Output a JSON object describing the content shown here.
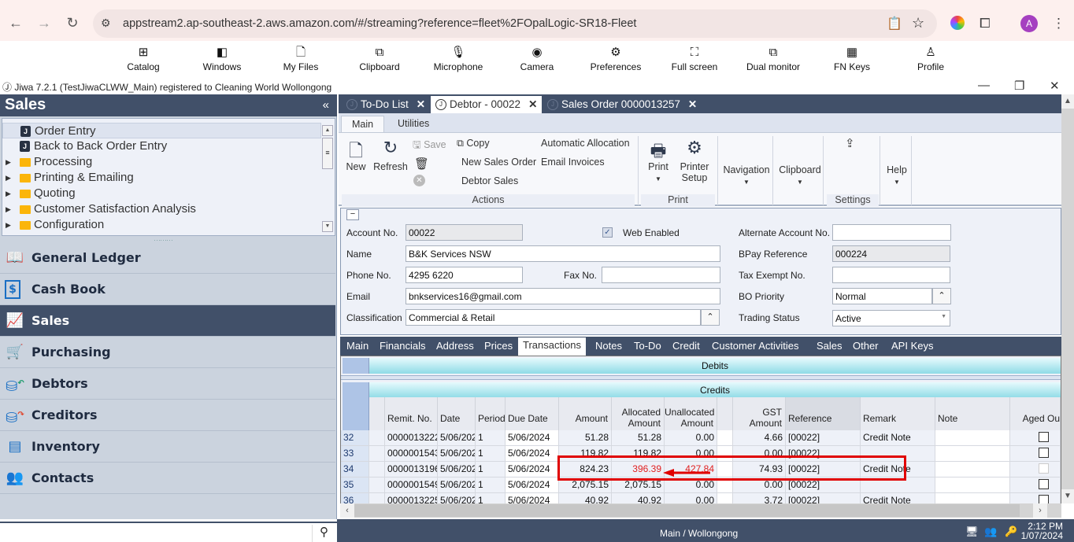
{
  "browser": {
    "url": "appstream2.ap-southeast-2.aws.amazon.com/#/streaming?reference=fleet%2FOpalLogic-SR18-Fleet",
    "back_icon": "arrow-left-icon",
    "forward_icon": "arrow-right-icon",
    "reload_icon": "reload-icon",
    "profile_initial": "A"
  },
  "appstream_toolbar": [
    {
      "label": "Catalog",
      "icon": "catalog-icon",
      "glyph": "⊞"
    },
    {
      "label": "Windows",
      "icon": "windows-icon",
      "glyph": "◧"
    },
    {
      "label": "My Files",
      "icon": "file-icon",
      "glyph": "🗋"
    },
    {
      "label": "Clipboard",
      "icon": "clipboard-icon",
      "glyph": "⧉"
    },
    {
      "label": "Microphone",
      "icon": "microphone-off-icon",
      "glyph": "🎙"
    },
    {
      "label": "Camera",
      "icon": "camera-icon",
      "glyph": "◉"
    },
    {
      "label": "Preferences",
      "icon": "gear-icon",
      "glyph": "⚙"
    },
    {
      "label": "Full screen",
      "icon": "fullscreen-icon",
      "glyph": "⛶"
    },
    {
      "label": "Dual monitor",
      "icon": "dual-monitor-icon",
      "glyph": "⧉"
    },
    {
      "label": "FN Keys",
      "icon": "keyboard-icon",
      "glyph": "▦"
    },
    {
      "label": "Profile",
      "icon": "user-icon",
      "glyph": "⍝"
    }
  ],
  "app": {
    "title": "Jiwa 7.2.1 (TestJiwaCLWW_Main) registered to Cleaning World Wollongong"
  },
  "sidebar": {
    "title": "Sales",
    "collapse_glyph": "«",
    "tree": [
      {
        "label": "Order Entry",
        "type": "item",
        "selected": true
      },
      {
        "label": "Back to Back Order Entry",
        "type": "item"
      },
      {
        "label": "Processing",
        "type": "folder"
      },
      {
        "label": "Printing & Emailing",
        "type": "folder"
      },
      {
        "label": "Quoting",
        "type": "folder"
      },
      {
        "label": "Customer Satisfaction Analysis",
        "type": "folder"
      },
      {
        "label": "Configuration",
        "type": "folder"
      }
    ],
    "modules": [
      {
        "label": "General Ledger",
        "icon": "ledger-book-icon",
        "glyph": "📖"
      },
      {
        "label": "Cash Book",
        "icon": "cash-book-icon",
        "glyph": "$"
      },
      {
        "label": "Sales",
        "icon": "sales-chart-icon",
        "glyph": "📈",
        "active": true
      },
      {
        "label": "Purchasing",
        "icon": "cart-icon",
        "glyph": "🛒"
      },
      {
        "label": "Debtors",
        "icon": "debtors-coins-icon",
        "glyph": "⛁"
      },
      {
        "label": "Creditors",
        "icon": "creditors-coins-icon",
        "glyph": "⛁"
      },
      {
        "label": "Inventory",
        "icon": "inventory-icon",
        "glyph": "▤"
      },
      {
        "label": "Contacts",
        "icon": "contacts-icon",
        "glyph": "👥"
      }
    ],
    "search_placeholder": ""
  },
  "doc_tabs": [
    {
      "label": "To-Do List"
    },
    {
      "label": "Debtor - 00022",
      "active": true
    },
    {
      "label": "Sales Order 0000013257"
    }
  ],
  "ribbon": {
    "tabs": [
      "Main",
      "Utilities"
    ],
    "new": "New",
    "refresh": "Refresh",
    "save": "Save",
    "copy": "Copy",
    "new_sales_order": "New Sales Order",
    "debtor_sales": "Debtor Sales",
    "automatic_allocation": "Automatic Allocation",
    "email_invoices": "Email Invoices",
    "actions_group": "Actions",
    "print": "Print",
    "printer_setup_1": "Printer",
    "printer_setup_2": "Setup",
    "print_group": "Print",
    "navigation": "Navigation",
    "clipboard": "Clipboard",
    "settings_group": "Settings",
    "help": "Help"
  },
  "form": {
    "account_no_label": "Account No.",
    "account_no": "00022",
    "web_enabled_label": "Web Enabled",
    "web_enabled": true,
    "name_label": "Name",
    "name": "B&K Services NSW",
    "phone_label": "Phone No.",
    "phone": "4295 6220",
    "fax_label": "Fax No.",
    "fax": "",
    "email_label": "Email",
    "email": "bnkservices16@gmail.com",
    "classification_label": "Classification",
    "classification": "Commercial & Retail",
    "alt_account_label": "Alternate Account No.",
    "alt_account": "",
    "bpay_label": "BPay Reference",
    "bpay": "000224",
    "tax_exempt_label": "Tax Exempt No.",
    "tax_exempt": "",
    "bo_priority_label": "BO Priority",
    "bo_priority": "Normal",
    "trading_status_label": "Trading Status",
    "trading_status": "Active"
  },
  "detail_tabs": [
    {
      "label": "Main"
    },
    {
      "label": "Financials"
    },
    {
      "label": "Address"
    },
    {
      "label": "Prices"
    },
    {
      "label": "Transactions",
      "active": true
    },
    {
      "label": "Notes"
    },
    {
      "label": "To-Do"
    },
    {
      "label": "Credit"
    },
    {
      "label": "Customer Activities"
    },
    {
      "label": "Sales"
    },
    {
      "label": "Other"
    },
    {
      "label": "API Keys"
    }
  ],
  "grid": {
    "debits_band": "Debits",
    "credits_band": "Credits",
    "columns": [
      "Remit. No.",
      "Date",
      "Period",
      "Due Date",
      "Amount",
      "Allocated Amount",
      "Unallocated Amount",
      "",
      "GST Amount",
      "Reference",
      "Remark",
      "Note",
      "Aged Ou"
    ],
    "rows": [
      {
        "n": "32",
        "remit": "0000013222-",
        "date": "5/06/202",
        "period": "1",
        "due": "5/06/2024",
        "amount": "51.28",
        "allocated": "51.28",
        "unallocated": "0.00",
        "gst": "4.66",
        "ref": "[00022]",
        "remark": "Credit Note",
        "note": "",
        "aged": false
      },
      {
        "n": "33",
        "remit": "0000001543",
        "date": "5/06/202",
        "period": "1",
        "due": "5/06/2024",
        "amount": "119.82",
        "allocated": "119.82",
        "unallocated": "0.00",
        "gst": "0.00",
        "ref": "[00022]",
        "remark": "",
        "note": "",
        "aged": false
      },
      {
        "n": "34",
        "remit": "0000013196-",
        "date": "5/06/202",
        "period": "1",
        "due": "5/06/2024",
        "amount": "824.23",
        "allocated": "396.39",
        "unallocated": "427.84",
        "gst": "74.93",
        "ref": "[00022]",
        "remark": "Credit Note",
        "note": "",
        "aged": false,
        "highlight": true
      },
      {
        "n": "35",
        "remit": "0000001549",
        "date": "5/06/202",
        "period": "1",
        "due": "5/06/2024",
        "amount": "2,075.15",
        "allocated": "2,075.15",
        "unallocated": "0.00",
        "gst": "0.00",
        "ref": "[00022]",
        "remark": "",
        "note": "",
        "aged": false
      },
      {
        "n": "36",
        "remit": "0000013225-",
        "date": "5/06/202",
        "period": "1",
        "due": "5/06/2024",
        "amount": "40.92",
        "allocated": "40.92",
        "unallocated": "0.00",
        "gst": "3.72",
        "ref": "[00022]",
        "remark": "Credit Note",
        "note": "",
        "aged": false
      }
    ]
  },
  "status": {
    "location": "Main / Wollongong",
    "time": "2:12 PM",
    "date": "1/07/2024"
  },
  "colors": {
    "header_navy": "#415069",
    "highlight_red": "#e00000",
    "alloc_red": "#e02020"
  }
}
